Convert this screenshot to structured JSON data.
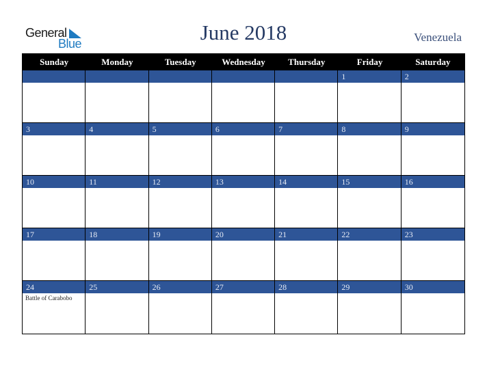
{
  "logo": {
    "line1": "General",
    "line2": "Blue"
  },
  "title": "June 2018",
  "country": "Venezuela",
  "colors": {
    "band": "#2e5597",
    "header": "#000000",
    "title": "#253a64",
    "logo_blue": "#1f7bc1"
  },
  "weekdays": [
    "Sunday",
    "Monday",
    "Tuesday",
    "Wednesday",
    "Thursday",
    "Friday",
    "Saturday"
  ],
  "weeks": [
    [
      {
        "day": ""
      },
      {
        "day": ""
      },
      {
        "day": ""
      },
      {
        "day": ""
      },
      {
        "day": ""
      },
      {
        "day": "1"
      },
      {
        "day": "2"
      }
    ],
    [
      {
        "day": "3"
      },
      {
        "day": "4"
      },
      {
        "day": "5"
      },
      {
        "day": "6"
      },
      {
        "day": "7"
      },
      {
        "day": "8"
      },
      {
        "day": "9"
      }
    ],
    [
      {
        "day": "10"
      },
      {
        "day": "11"
      },
      {
        "day": "12"
      },
      {
        "day": "13"
      },
      {
        "day": "14"
      },
      {
        "day": "15"
      },
      {
        "day": "16"
      }
    ],
    [
      {
        "day": "17"
      },
      {
        "day": "18"
      },
      {
        "day": "19"
      },
      {
        "day": "20"
      },
      {
        "day": "21"
      },
      {
        "day": "22"
      },
      {
        "day": "23"
      }
    ],
    [
      {
        "day": "24",
        "event": "Battle of Carabobo"
      },
      {
        "day": "25"
      },
      {
        "day": "26"
      },
      {
        "day": "27"
      },
      {
        "day": "28"
      },
      {
        "day": "29"
      },
      {
        "day": "30"
      }
    ]
  ]
}
